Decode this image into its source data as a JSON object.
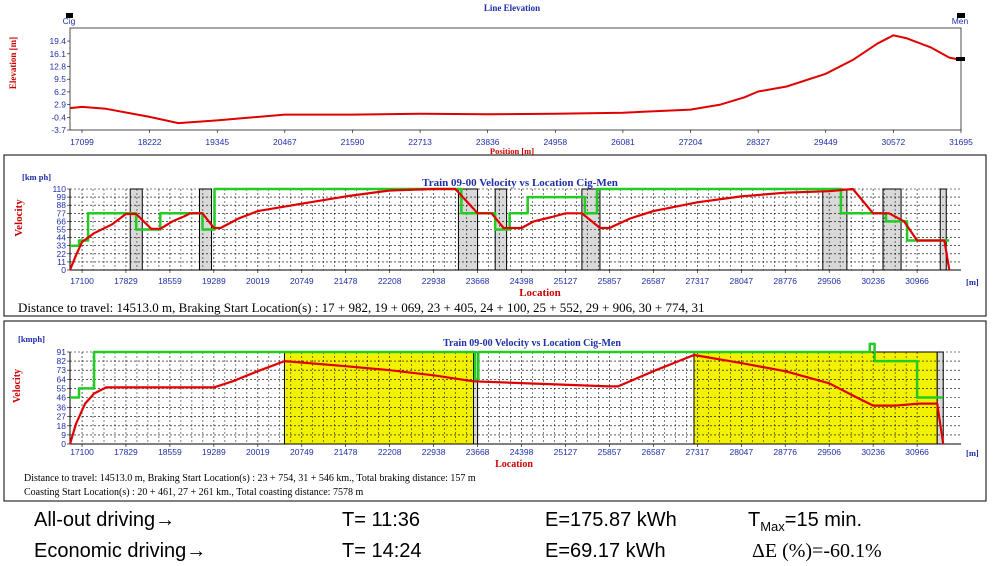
{
  "chart_data": [
    {
      "type": "line",
      "title": "Line Elevation",
      "xlabel": "Position [m]",
      "ylabel": "Elevation [m]",
      "start_label": "Cig",
      "end_label": "Men",
      "xlim": [
        16900,
        31695
      ],
      "ylim": [
        -3.7,
        22.8
      ],
      "x_ticks": [
        "17099",
        "18222",
        "19345",
        "20467",
        "21590",
        "22713",
        "23836",
        "24958",
        "26081",
        "27204",
        "28327",
        "29449",
        "30572",
        "31695"
      ],
      "y_ticks": [
        "-3.7",
        "-0.4",
        "2.9",
        "6.2",
        "9.5",
        "12.8",
        "16.1",
        "19.4"
      ],
      "series": [
        {
          "color": "#e00000",
          "x": [
            16900,
            17099,
            17500,
            18222,
            18700,
            19345,
            20467,
            21590,
            22713,
            23836,
            24958,
            26081,
            27204,
            27700,
            28100,
            28327,
            28800,
            29449,
            29900,
            30300,
            30572,
            30800,
            31200,
            31500,
            31695
          ],
          "y": [
            2.0,
            2.3,
            1.8,
            -0.3,
            -1.9,
            -1.2,
            0.3,
            0.3,
            0.5,
            0.4,
            0.5,
            0.8,
            1.6,
            2.9,
            4.8,
            6.3,
            7.6,
            10.9,
            14.5,
            18.7,
            20.9,
            20.1,
            17.7,
            15.1,
            14.5
          ]
        }
      ]
    },
    {
      "type": "line",
      "title": "Train 09-00 Velocity vs Location Cig-Men",
      "xlabel": "Location",
      "ylabel": "Velocity",
      "y_unit": "[km ph]",
      "x_unit": "[m]",
      "xlim": [
        16900,
        31695
      ],
      "ylim": [
        0,
        110
      ],
      "x_ticks": [
        "17100",
        "17829",
        "18559",
        "19289",
        "20019",
        "20749",
        "21478",
        "22208",
        "22938",
        "23668",
        "24398",
        "25127",
        "25857",
        "26587",
        "27317",
        "28047",
        "28776",
        "29506",
        "30236",
        "30966"
      ],
      "y_ticks": [
        "0",
        "11",
        "22",
        "33",
        "44",
        "55",
        "66",
        "77",
        "88",
        "99",
        "110"
      ],
      "braking_zones": [
        [
          17900,
          18100
        ],
        [
          19050,
          19250
        ],
        [
          23350,
          23668
        ],
        [
          23960,
          24150
        ],
        [
          25400,
          25700
        ],
        [
          29400,
          29800
        ],
        [
          30400,
          30700
        ],
        [
          31350,
          31450
        ]
      ],
      "series": [
        {
          "name": "speed-limit",
          "color": "#22cc22",
          "x": [
            16900,
            17050,
            17050,
            17200,
            17200,
            18000,
            18000,
            18400,
            18400,
            19100,
            19100,
            19300,
            19300,
            23400,
            23400,
            23960,
            23960,
            24200,
            24200,
            24500,
            24500,
            25450,
            25450,
            25650,
            25650,
            29700,
            29700,
            30450,
            30450,
            30800,
            30800,
            31500
          ],
          "y": [
            33,
            33,
            40,
            40,
            77,
            77,
            55,
            55,
            77,
            77,
            55,
            55,
            110,
            110,
            77,
            77,
            55,
            55,
            77,
            77,
            99,
            99,
            77,
            77,
            110,
            110,
            77,
            77,
            66,
            66,
            40,
            40
          ]
        },
        {
          "name": "velocity",
          "color": "#e00000",
          "x": [
            16900,
            17000,
            17100,
            17300,
            17600,
            17829,
            18000,
            18250,
            18400,
            18600,
            18800,
            18900,
            19100,
            19289,
            19400,
            19700,
            20019,
            20749,
            21478,
            22208,
            22938,
            23300,
            23668,
            23900,
            24100,
            24398,
            24600,
            24900,
            25127,
            25400,
            25700,
            25857,
            26200,
            26587,
            27317,
            28047,
            28776,
            29506,
            29900,
            30236,
            30500,
            30750,
            30966,
            31150,
            31300,
            31420,
            31500
          ],
          "y": [
            0,
            20,
            38,
            50,
            62,
            76,
            76,
            56,
            56,
            66,
            73,
            77,
            77,
            57,
            57,
            70,
            80,
            90,
            100,
            108,
            110,
            110,
            77,
            77,
            57,
            57,
            66,
            72,
            77,
            77,
            57,
            57,
            70,
            80,
            92,
            100,
            105,
            107,
            110,
            77,
            77,
            66,
            40,
            40,
            40,
            40,
            0
          ]
        }
      ],
      "info_line": "Distance to travel: 14513.0 m,  Braking Start Location(s) : 17 + 982, 19 + 069, 23 + 405, 24 + 100, 25 + 552, 29 + 906, 30 + 774, 31"
    },
    {
      "type": "line",
      "title": "Train 09-00 Velocity vs Location Cig-Men",
      "xlabel": "Location",
      "ylabel": "Velocity",
      "y_unit": "[kmph]",
      "x_unit": "[m]",
      "xlim": [
        16900,
        31695
      ],
      "ylim": [
        0,
        91
      ],
      "x_ticks": [
        "17100",
        "17829",
        "18559",
        "19289",
        "20019",
        "20749",
        "21478",
        "22208",
        "22938",
        "23668",
        "24398",
        "25127",
        "25857",
        "26587",
        "27317",
        "28047",
        "28776",
        "29506",
        "30236",
        "30966"
      ],
      "y_ticks": [
        "0",
        "9",
        "18",
        "27",
        "36",
        "46",
        "55",
        "64",
        "73",
        "82",
        "91"
      ],
      "coasting_zones": [
        [
          20461,
          23600
        ],
        [
          27261,
          31300
        ]
      ],
      "braking_zones": [
        [
          23600,
          23668
        ],
        [
          31300,
          31400
        ]
      ],
      "series": [
        {
          "name": "speed-limit",
          "color": "#22cc22",
          "x": [
            16900,
            17050,
            17050,
            17300,
            17300,
            23625,
            23625,
            23680,
            23680,
            30180,
            30180,
            30260,
            30260,
            30966,
            30966,
            31400
          ],
          "y": [
            46,
            46,
            55,
            55,
            91,
            91,
            64,
            64,
            91,
            91,
            99,
            99,
            82,
            82,
            46,
            46
          ]
        },
        {
          "name": "velocity",
          "color": "#e00000",
          "x": [
            16900,
            17000,
            17150,
            17300,
            17500,
            19289,
            19600,
            20019,
            20461,
            21478,
            22208,
            22938,
            23600,
            25857,
            26000,
            26587,
            27261,
            28047,
            28776,
            29506,
            29900,
            30236,
            30600,
            31000,
            31300,
            31400
          ],
          "y": [
            0,
            20,
            40,
            50,
            56,
            56,
            62,
            72,
            82,
            77,
            73,
            68,
            62,
            57,
            57,
            72,
            88,
            80,
            72,
            60,
            48,
            38,
            38,
            40,
            40,
            0
          ]
        }
      ],
      "info_lines": [
        "Distance to travel: 14513.0 m,  Braking Start Location(s) : 23 + 754, 31 + 546 km.,  Total braking distance:    157 m",
        "Coasting Start Location(s) : 20 + 461, 27 + 261 km.,  Total coasting distance:    7578 m"
      ]
    }
  ],
  "summary": {
    "rows": [
      {
        "mode": "All-out driving",
        "time": "T= 11:36",
        "energy": "E=175.87 kWh",
        "extra": "T",
        "extra_sub": "Max",
        "extra_tail": "=15 min."
      },
      {
        "mode": "Economic driving",
        "time": "T= 14:24",
        "energy": "E=69.17 kWh",
        "extra": "ΔE (%)=-60.1%",
        "extra_sub": "",
        "extra_tail": ""
      }
    ],
    "arrow": "→"
  },
  "colors": {
    "line": "#e00000",
    "limit": "#22cc22",
    "coast": "#f2f200",
    "brake": "#d9d9d9",
    "text_blue": "#1f2fa8"
  }
}
